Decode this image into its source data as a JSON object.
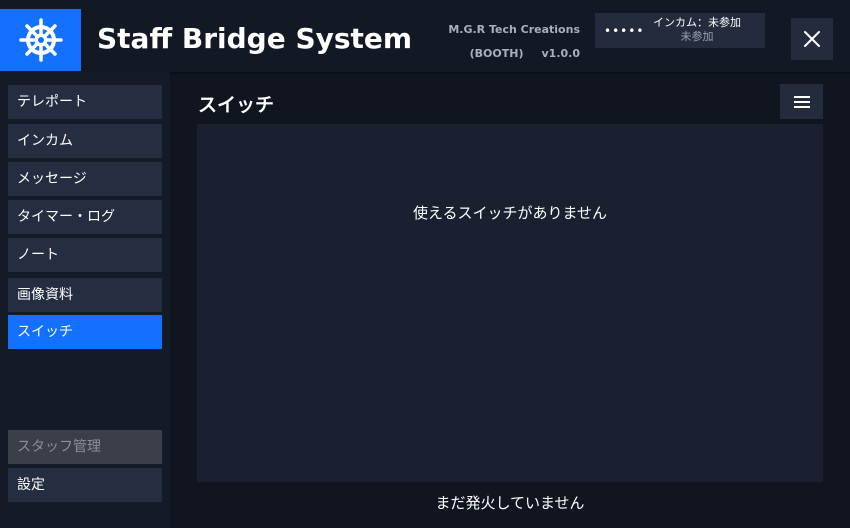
{
  "header": {
    "app_title": "Staff Bridge System",
    "credit_author": "M.G.R Tech Creations",
    "credit_store": "(BOOTH)",
    "version": "v1.0.0",
    "intercom_dots": "•••••",
    "intercom_status": "インカム：未参加",
    "intercom_substatus": "未参加",
    "logo_icon": "ship-wheel-icon",
    "close_icon": "close-icon"
  },
  "sidebar": {
    "items": [
      {
        "label": "テレポート"
      },
      {
        "label": "インカム"
      },
      {
        "label": "メッセージ"
      },
      {
        "label": "タイマー・ログ"
      },
      {
        "label": "ノート"
      },
      {
        "label": "画像資料"
      },
      {
        "label": "スイッチ"
      }
    ],
    "bottom_items": [
      {
        "label": "スタッフ管理"
      },
      {
        "label": "設定"
      }
    ],
    "active_label": "スイッチ"
  },
  "main": {
    "title": "スイッチ",
    "menu_icon": "hamburger-menu-icon",
    "empty_message": "使えるスイッチがありません"
  },
  "footer": {
    "message": "まだ発火していません"
  },
  "colors": {
    "accent": "#1470ff",
    "background": "#101520",
    "panel": "#1a2030",
    "button": "#252d40",
    "disabled": "#3b3f47"
  }
}
